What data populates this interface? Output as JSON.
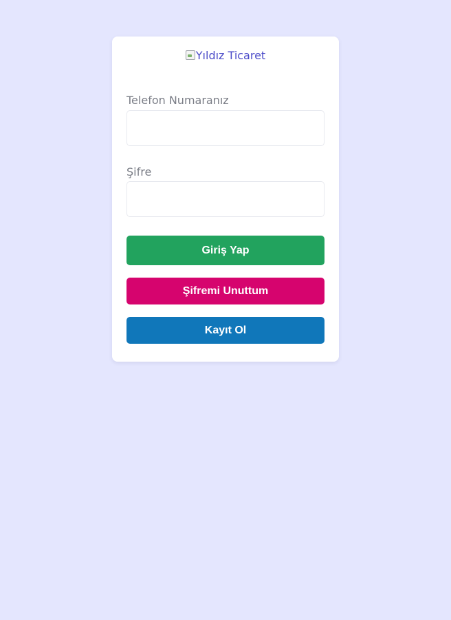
{
  "logo": {
    "alt_text": "Yıldız Ticaret"
  },
  "form": {
    "phone": {
      "label": "Telefon Numaranız",
      "value": ""
    },
    "password": {
      "label": "Şifre",
      "value": ""
    }
  },
  "buttons": {
    "login": "Giriş Yap",
    "forgot_password": "Şifremi Unuttum",
    "register": "Kayıt Ol"
  },
  "colors": {
    "background": "#e4e6fe",
    "login": "#22a35e",
    "forgot_password": "#d6046e",
    "register": "#1077ba"
  }
}
